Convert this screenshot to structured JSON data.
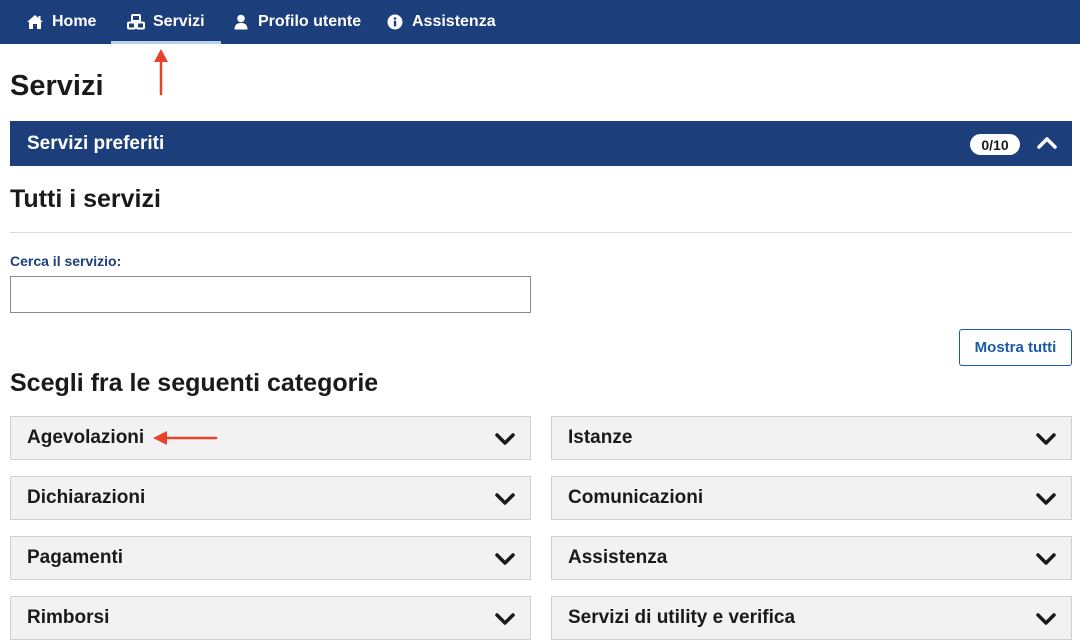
{
  "nav": {
    "items": [
      {
        "label": "Home",
        "icon": "home-icon"
      },
      {
        "label": "Servizi",
        "icon": "services-icon",
        "active": true
      },
      {
        "label": "Profilo utente",
        "icon": "user-icon"
      },
      {
        "label": "Assistenza",
        "icon": "info-icon"
      }
    ]
  },
  "page": {
    "title": "Servizi"
  },
  "favorites": {
    "title": "Servizi preferiti",
    "badge": "0/10",
    "expanded": true
  },
  "all_services": {
    "title": "Tutti i servizi",
    "search_label": "Cerca il servizio:",
    "search_value": "",
    "show_all_label": "Mostra tutti"
  },
  "categories": {
    "title": "Scegli fra le seguenti categorie",
    "left": [
      "Agevolazioni",
      "Dichiarazioni",
      "Pagamenti",
      "Rimborsi"
    ],
    "right": [
      "Istanze",
      "Comunicazioni",
      "Assistenza",
      "Servizi di utility e verifica"
    ]
  },
  "colors": {
    "primary": "#1c3f7c",
    "link": "#1c5aa8",
    "annotation": "#e8412c",
    "category_bg": "#f2f2f2"
  }
}
